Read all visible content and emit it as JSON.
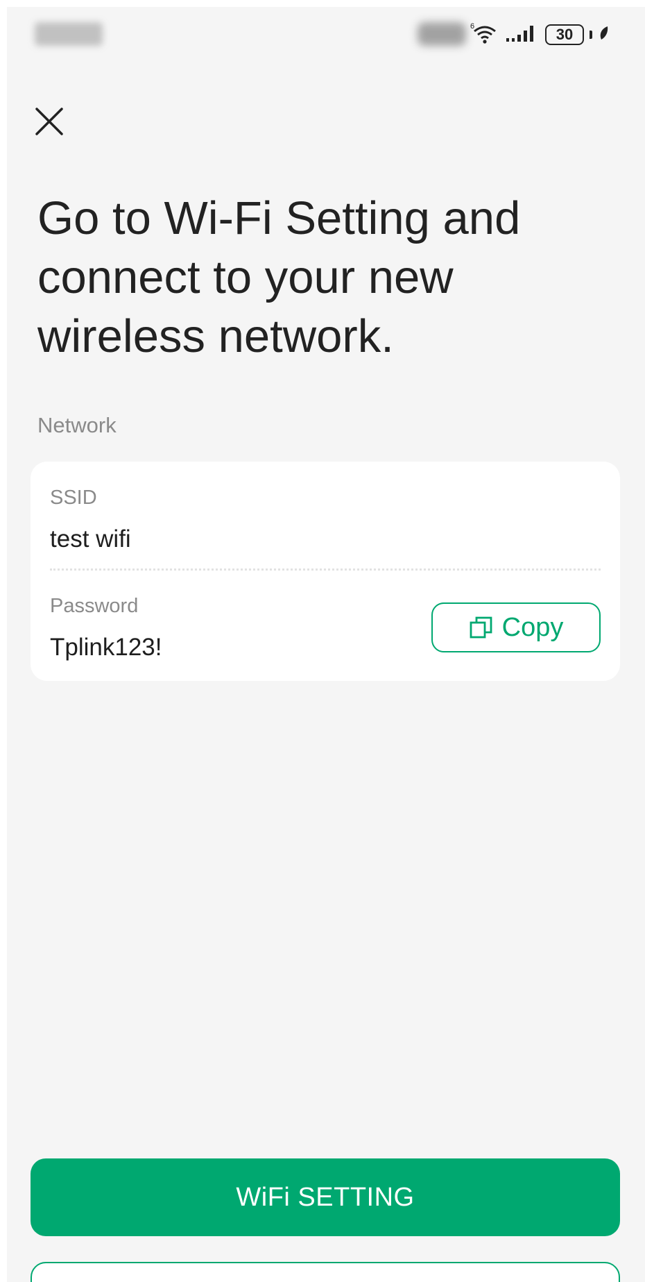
{
  "colors": {
    "accent": "#00a870",
    "background": "#f5f5f5",
    "card": "#ffffff",
    "text_primary": "#222222",
    "text_secondary": "#8a8a8a"
  },
  "status_bar": {
    "battery_level": "30",
    "icons": [
      "wifi-icon",
      "signal-icon",
      "battery-icon",
      "leaf-icon"
    ]
  },
  "header": {
    "close_icon": "close-icon"
  },
  "title": "Go to Wi-Fi Setting and connect to your new wireless network.",
  "network_section": {
    "label": "Network",
    "ssid_label": "SSID",
    "ssid_value": "test wifi",
    "password_label": "Password",
    "password_value": "Tplink123!",
    "copy_label": "Copy",
    "copy_icon": "copy-icon"
  },
  "buttons": {
    "wifi_setting_label": "WiFi SETTING"
  }
}
